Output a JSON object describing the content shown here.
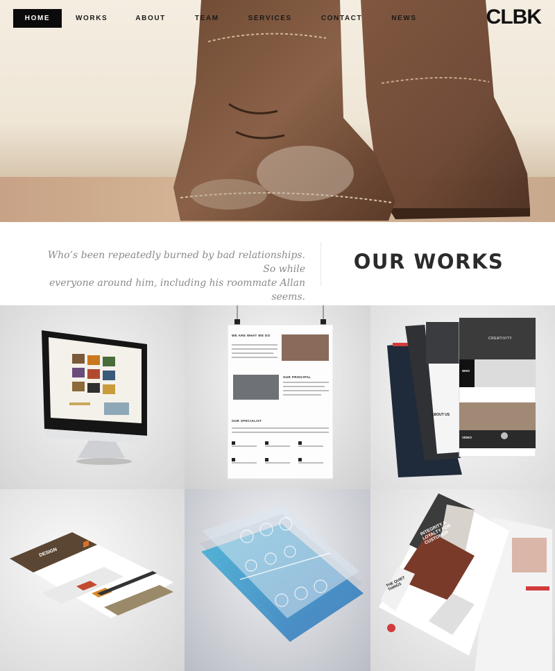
{
  "brand": {
    "logo": "CLBK"
  },
  "nav": {
    "items": [
      {
        "label": "HOME",
        "active": true
      },
      {
        "label": "WORKS"
      },
      {
        "label": "ABOUT"
      },
      {
        "label": "TEAM"
      },
      {
        "label": "SERVICES"
      },
      {
        "label": "CONTACT"
      },
      {
        "label": "NEWS"
      }
    ]
  },
  "intro": {
    "quote_line1": "Who’s been repeatedly burned by bad relationships. So while",
    "quote_line2": "everyone around him, including his roommate Allan seems.",
    "title": "OUR WORKS"
  },
  "works": {
    "items": [
      {
        "mockup": "desktop-monitor"
      },
      {
        "mockup": "hanging-poster",
        "headings": [
          "WE ARE WHAT WE DO",
          "OUR PRINCIPAL",
          "OUR SPECIALIST"
        ]
      },
      {
        "mockup": "layered-mobile-pages",
        "labels": [
          "ABOUT US",
          "CREATIVITY",
          "WHO",
          "VIDEO"
        ]
      },
      {
        "mockup": "tilted-website-design",
        "labels": [
          "DESIGN"
        ]
      },
      {
        "mockup": "layered-app-ui"
      },
      {
        "mockup": "tilted-magazine-site",
        "labels": [
          "INTEGRITY & LOYALTY FOR CUSTOMER",
          "THE QUIET THINGS"
        ]
      }
    ]
  },
  "colors": {
    "nav_active_bg": "#0b0b0b",
    "accent_red": "#d23b3b",
    "text_dark": "#2b2b2b",
    "quote_gray": "#8a8a8a"
  }
}
